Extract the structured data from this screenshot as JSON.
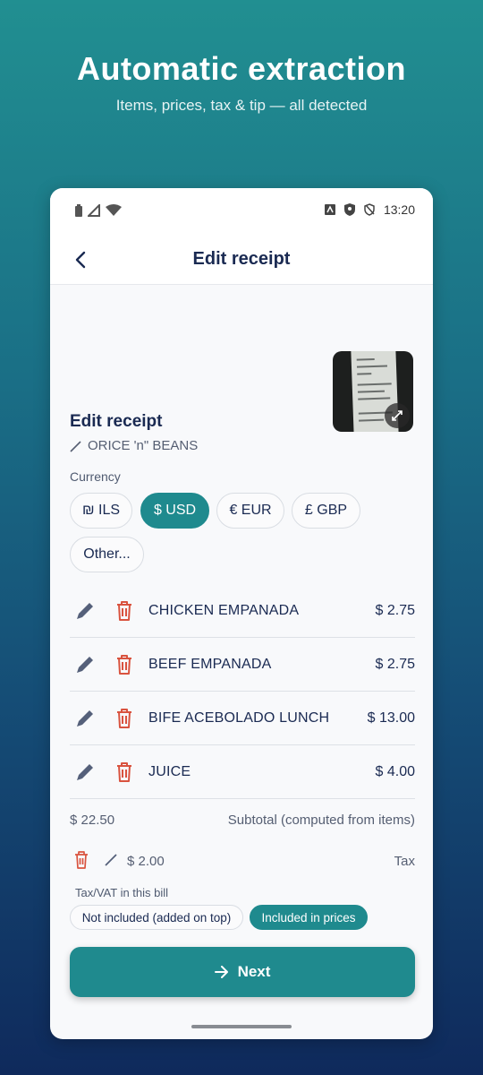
{
  "hero": {
    "title": "Automatic extraction",
    "subtitle": "Items, prices, tax & tip — all detected"
  },
  "status_bar": {
    "time": "13:20",
    "left_icons": [
      "battery-icon",
      "signal-icon",
      "wifi-icon"
    ],
    "right_icons": [
      "notification-icon",
      "shield-icon",
      "vpn-icon"
    ]
  },
  "app_bar": {
    "title": "Edit receipt",
    "back_icon": "chevron-left-icon"
  },
  "receipt": {
    "section_title": "Edit receipt",
    "merchant": "ORICE 'n\" BEANS",
    "thumbnail_icon": "expand-icon"
  },
  "currency": {
    "label": "Currency",
    "options": [
      {
        "label": "₪ ILS",
        "selected": false
      },
      {
        "label": "$ USD",
        "selected": true
      },
      {
        "label": "€ EUR",
        "selected": false
      },
      {
        "label": "£ GBP",
        "selected": false
      },
      {
        "label": "Other...",
        "selected": false
      }
    ]
  },
  "items": [
    {
      "name": "CHICKEN EMPANADA",
      "price": "$ 2.75"
    },
    {
      "name": "BEEF EMPANADA",
      "price": "$ 2.75"
    },
    {
      "name": "BIFE ACEBOLADO LUNCH",
      "price": "$ 13.00"
    },
    {
      "name": "JUICE",
      "price": "$ 4.00"
    }
  ],
  "subtotal": {
    "value": "$ 22.50",
    "label": "Subtotal (computed from items)"
  },
  "tax": {
    "value": "$ 2.00",
    "label": "Tax",
    "mode_label": "Tax/VAT in this bill",
    "options": [
      {
        "label": "Not included (added on top)",
        "selected": false
      },
      {
        "label": "Included in prices",
        "selected": true
      }
    ]
  },
  "next_button": {
    "label": "Next",
    "icon": "arrow-right-icon"
  },
  "colors": {
    "accent": "#1f8a8e",
    "delete": "#d9533f",
    "text": "#1a2a52"
  }
}
